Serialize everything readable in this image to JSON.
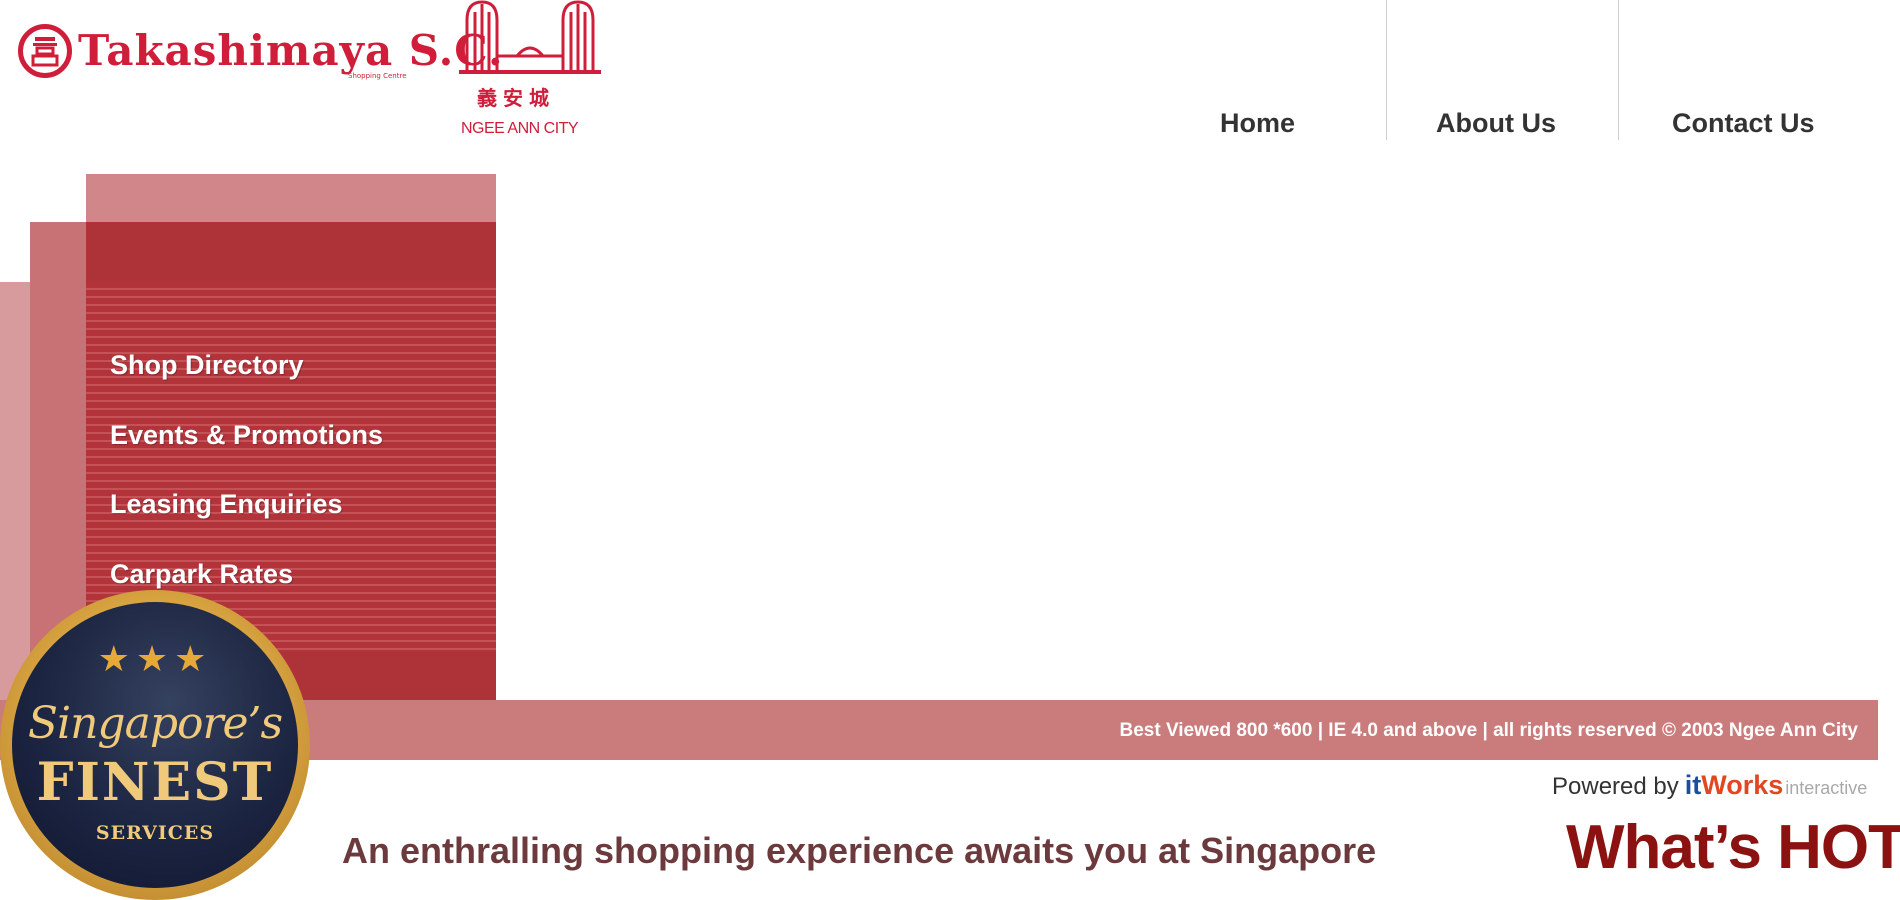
{
  "header": {
    "logo_primary": "Takashimaya S.C.",
    "logo_primary_sub": "Shopping Centre",
    "logo_secondary_chinese": "義安城",
    "logo_secondary": "NGEE ANN CITY",
    "nav": [
      {
        "label": "Home"
      },
      {
        "label": "About Us"
      },
      {
        "label": "Contact Us"
      }
    ]
  },
  "sidebar": {
    "items": [
      {
        "label": "Shop Directory"
      },
      {
        "label": "Events & Promotions"
      },
      {
        "label": "Leasing Enquiries"
      },
      {
        "label": "Carpark Rates"
      }
    ]
  },
  "footer": {
    "copyright": "Best Viewed 800 *600 | IE 4.0 and above | all rights reserved © 2003 Ngee Ann City",
    "powered_label": "Powered by",
    "powered_it": "it",
    "powered_works": "Works",
    "powered_interactive": "interactive",
    "ticker": "An enthralling shopping experience awaits you at Singapore’s ic",
    "whats_hot": "What’s HOT"
  },
  "badge": {
    "stars": "★★★",
    "script": "Singapore’s",
    "finest": "FINEST",
    "services": "SERVICES"
  },
  "colors": {
    "brand_red": "#d01d3a",
    "menu_red": "#ae3339",
    "footer_pink": "#ca7b7c",
    "hot_red": "#8c1212"
  }
}
